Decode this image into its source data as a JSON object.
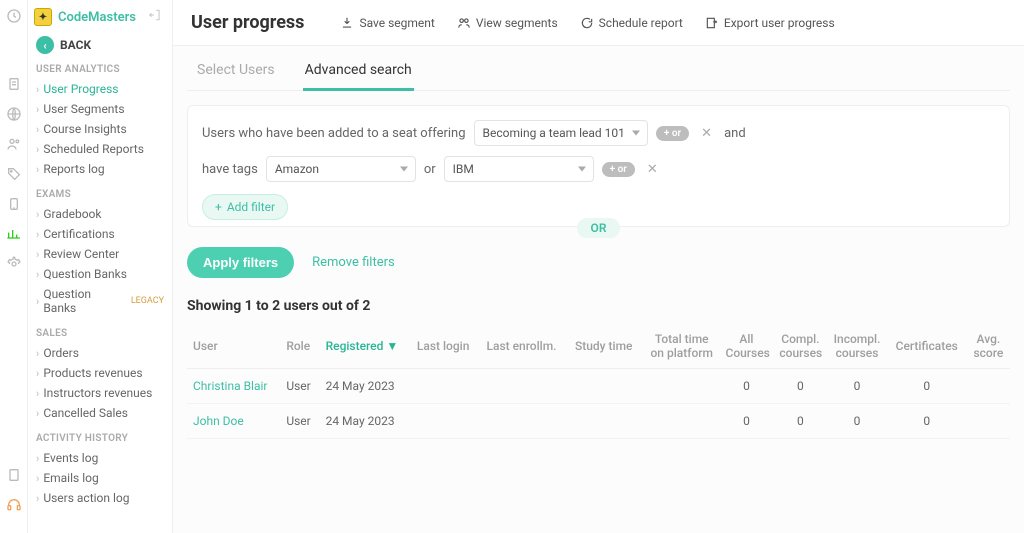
{
  "brand": {
    "name": "CodeMasters"
  },
  "back_label": "BACK",
  "sidebar": {
    "sections": [
      {
        "title": "USER ANALYTICS",
        "items": [
          {
            "label": "User Progress",
            "active": true
          },
          {
            "label": "User Segments"
          },
          {
            "label": "Course Insights"
          },
          {
            "label": "Scheduled Reports"
          },
          {
            "label": "Reports log"
          }
        ]
      },
      {
        "title": "EXAMS",
        "items": [
          {
            "label": "Gradebook"
          },
          {
            "label": "Certifications"
          },
          {
            "label": "Review Center"
          },
          {
            "label": "Question Banks"
          },
          {
            "label": "Question Banks",
            "badge": "LEGACY"
          }
        ]
      },
      {
        "title": "SALES",
        "items": [
          {
            "label": "Orders"
          },
          {
            "label": "Products revenues"
          },
          {
            "label": "Instructors revenues"
          },
          {
            "label": "Cancelled Sales"
          }
        ]
      },
      {
        "title": "ACTIVITY HISTORY",
        "items": [
          {
            "label": "Events log"
          },
          {
            "label": "Emails log"
          },
          {
            "label": "Users action log"
          }
        ]
      }
    ]
  },
  "page_title": "User progress",
  "top_actions": {
    "save": "Save segment",
    "view": "View segments",
    "schedule": "Schedule report",
    "export": "Export user progress"
  },
  "tabs": {
    "select": "Select Users",
    "advanced": "Advanced search"
  },
  "filters": {
    "line1_prefix": "Users who have been added to a seat offering",
    "offering_value": "Becoming a team lead 101",
    "conj_or": "+ or",
    "and": "and",
    "line2_prefix": "have tags",
    "tag1": "Amazon",
    "or": "or",
    "tag2": "IBM",
    "add_filter": "Add filter",
    "big_or": "OR"
  },
  "apply_button": "Apply filters",
  "remove_filters": "Remove filters",
  "result_text": "Showing 1 to 2 users out of 2",
  "columns": {
    "user": "User",
    "role": "Role",
    "registered": "Registered ▼",
    "last_login": "Last login",
    "last_enroll": "Last enrollm.",
    "study_time": "Study time",
    "total_time": "Total time on platform",
    "all_courses": "All Courses",
    "compl": "Compl. courses",
    "incompl": "Incompl. courses",
    "certs": "Certificates",
    "avg": "Avg. score"
  },
  "rows": [
    {
      "user": "Christina Blair",
      "role": "User",
      "registered": "24 May 2023",
      "all": "0",
      "compl": "0",
      "incompl": "0",
      "certs": "0"
    },
    {
      "user": "John Doe",
      "role": "User",
      "registered": "24 May 2023",
      "all": "0",
      "compl": "0",
      "incompl": "0",
      "certs": "0"
    }
  ]
}
